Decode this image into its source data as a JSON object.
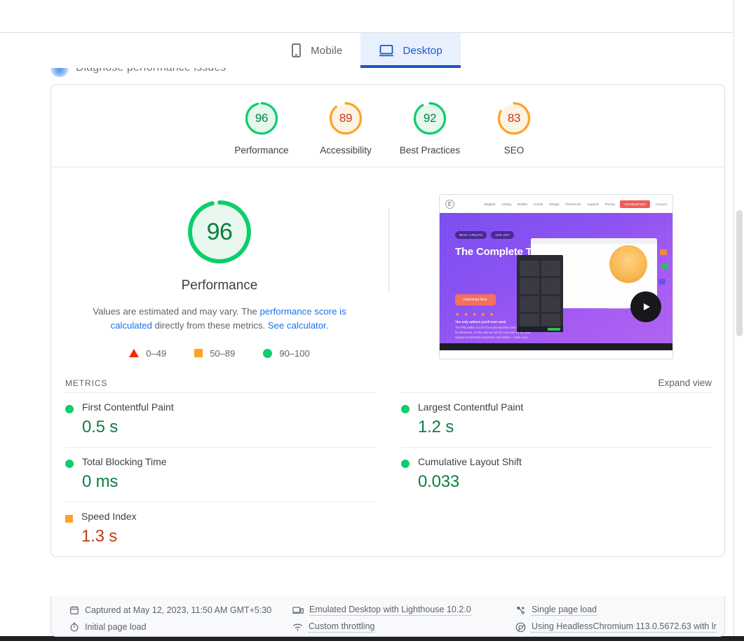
{
  "background_row": {
    "label": "Diagnose performance issues"
  },
  "tabs": [
    {
      "id": "mobile",
      "label": "Mobile",
      "icon": "mobile-phone-icon",
      "active": false
    },
    {
      "id": "desktop",
      "label": "Desktop",
      "icon": "desktop-monitor-icon",
      "active": true
    }
  ],
  "category_scores": [
    {
      "label": "Performance",
      "value": 96,
      "rating": "good"
    },
    {
      "label": "Accessibility",
      "value": 89,
      "rating": "average"
    },
    {
      "label": "Best Practices",
      "value": 92,
      "rating": "good"
    },
    {
      "label": "SEO",
      "value": 83,
      "rating": "average"
    }
  ],
  "hero": {
    "score": 96,
    "label": "Performance",
    "note_part1": "Values are estimated and may vary. The ",
    "note_link1": "performance score is calculated",
    "note_part2": " directly from these metrics. ",
    "note_link2": "See calculator",
    "note_part3": ".",
    "legend": [
      {
        "shape": "triangle",
        "range": "0–49",
        "color": "#f42c04"
      },
      {
        "shape": "square",
        "range": "50–89",
        "color": "#fca326"
      },
      {
        "shape": "circle",
        "range": "90–100",
        "color": "#0cce6b"
      }
    ]
  },
  "screenshot": {
    "alt": "page-screenshot-thumbnail",
    "nav_items": [
      "Widgets",
      "Listing",
      "Builder",
      "Extras",
      "Design",
      "Resources",
      "Support",
      "Pricing"
    ],
    "nav_cta": "Download Now",
    "nav_account": "Account",
    "badges": [
      "BEST UPDATE",
      "10% OFF"
    ],
    "headline": "The Complete Toolkit for Elementor",
    "cta": "Download Now",
    "stars": "★ ★ ★ ★ ★",
    "quote_title": "The only addons you'll ever need",
    "quote_body": "The Plus addon is a for the most extensive and impressive add-on for Elementor. It's the only we use for every site by far, and I support is extremely responsive and helpful – made a pro.",
    "see_in_action": "See in Action"
  },
  "metrics_section": {
    "title": "METRICS",
    "expand_label": "Expand view",
    "left_column": [
      {
        "name": "First Contentful Paint",
        "value": "0.5 s",
        "rating": "good",
        "color": "#0b8043",
        "mark": "circle"
      },
      {
        "name": "Total Blocking Time",
        "value": "0 ms",
        "rating": "good",
        "color": "#0b8043",
        "mark": "circle"
      },
      {
        "name": "Speed Index",
        "value": "1.3 s",
        "rating": "average",
        "color": "#c5391b",
        "mark": "square"
      }
    ],
    "right_column": [
      {
        "name": "Largest Contentful Paint",
        "value": "1.2 s",
        "rating": "good",
        "color": "#0b8043",
        "mark": "circle"
      },
      {
        "name": "Cumulative Layout Shift",
        "value": "0.033",
        "rating": "good",
        "color": "#0b8043",
        "mark": "circle"
      }
    ]
  },
  "footer": {
    "items": [
      {
        "icon": "calendar-icon",
        "text": "Captured at May 12, 2023, 11:50 AM GMT+5:30",
        "dotted": false
      },
      {
        "icon": "device-icon",
        "text": "Emulated Desktop with Lighthouse 10.2.0",
        "dotted": true
      },
      {
        "icon": "network-icon",
        "text": "Single page load",
        "dotted": true
      },
      {
        "icon": "stopwatch-icon",
        "text": "Initial page load",
        "dotted": false
      },
      {
        "icon": "throttling-icon",
        "text": "Custom throttling",
        "dotted": true
      },
      {
        "icon": "chrome-icon",
        "text": "Using HeadlessChromium 113.0.5672.63 with lr",
        "dotted": true
      }
    ]
  },
  "colors": {
    "good": "#0cce6b",
    "good_text": "#0b8043",
    "average": "#fca326",
    "average_text": "#c5391b",
    "poor": "#f42c04",
    "link": "#1a73e8",
    "tab_active": "#1a56c4"
  }
}
